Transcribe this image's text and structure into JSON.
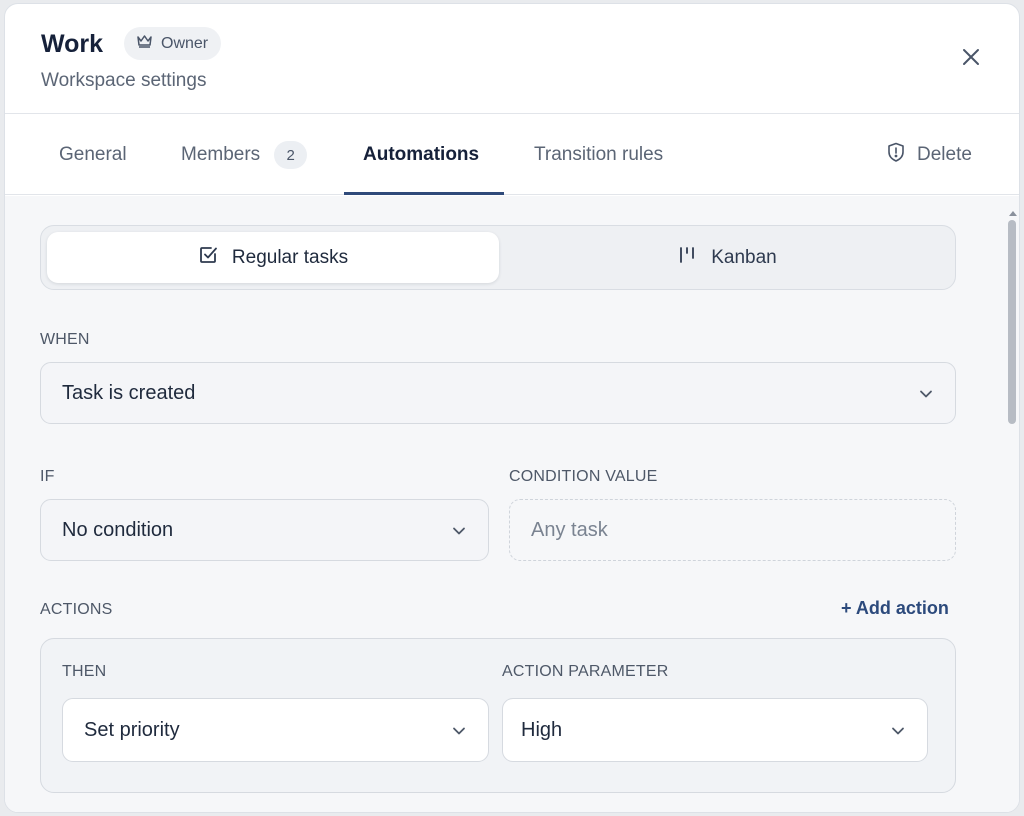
{
  "header": {
    "title": "Work",
    "owner_badge": "Owner",
    "subtitle": "Workspace settings"
  },
  "tabs": [
    {
      "label": "General"
    },
    {
      "label": "Members",
      "count": "2"
    },
    {
      "label": "Automations",
      "active": true
    },
    {
      "label": "Transition rules"
    }
  ],
  "delete_label": "Delete",
  "segment": {
    "regular_label": "Regular tasks",
    "kanban_label": "Kanban",
    "selected": "Regular tasks"
  },
  "when": {
    "label": "WHEN",
    "value": "Task is created"
  },
  "if": {
    "label": "IF",
    "value": "No condition"
  },
  "condition_value": {
    "label": "CONDITION VALUE",
    "placeholder": "Any task"
  },
  "actions": {
    "label": "ACTIONS",
    "add_label": "+ Add action",
    "then_label": "THEN",
    "then_value": "Set priority",
    "param_label": "ACTION PARAMETER",
    "param_value": "High"
  },
  "colors": {
    "accent": "#2f4a7a",
    "link": "#2c4a7c",
    "text": "#1f2a3d",
    "muted": "#5b6575"
  }
}
